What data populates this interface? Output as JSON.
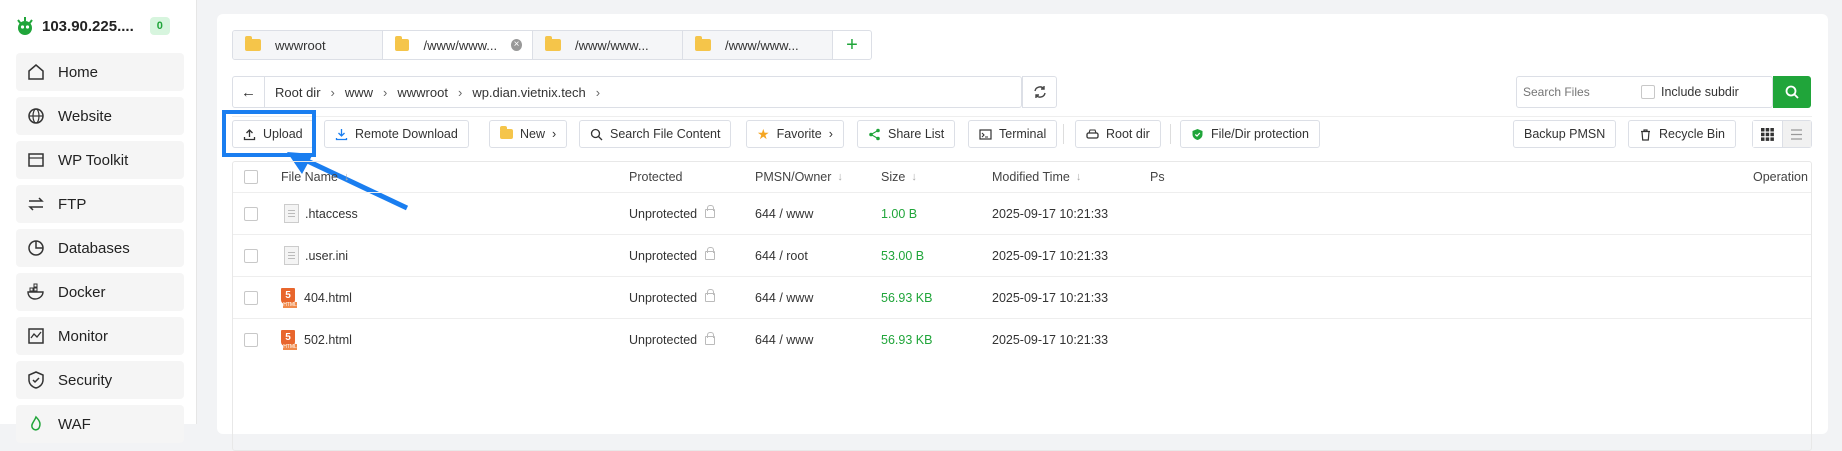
{
  "sidebar": {
    "server": "103.90.225....",
    "badge": "0",
    "items": [
      {
        "label": "Home",
        "icon": "home-icon"
      },
      {
        "label": "Website",
        "icon": "globe-icon"
      },
      {
        "label": "WP Toolkit",
        "icon": "wp-toolkit-icon"
      },
      {
        "label": "FTP",
        "icon": "ftp-icon"
      },
      {
        "label": "Databases",
        "icon": "database-icon"
      },
      {
        "label": "Docker",
        "icon": "docker-icon"
      },
      {
        "label": "Monitor",
        "icon": "monitor-icon"
      },
      {
        "label": "Security",
        "icon": "shield-icon"
      },
      {
        "label": "WAF",
        "icon": "waf-icon"
      }
    ]
  },
  "tabs": [
    {
      "label": "wwwroot"
    },
    {
      "label": "/www/www..."
    },
    {
      "label": "/www/www..."
    },
    {
      "label": "/www/www..."
    }
  ],
  "path": {
    "crumbs": [
      "Root dir",
      "www",
      "wwwroot",
      "wp.dian.vietnix.tech"
    ]
  },
  "search": {
    "placeholder": "Search Files",
    "include_subdir": "Include subdir"
  },
  "toolbar": {
    "upload": "Upload",
    "remote_download": "Remote Download",
    "new": "New",
    "search_content": "Search File Content",
    "favorite": "Favorite",
    "share_list": "Share List",
    "terminal": "Terminal",
    "root_dir": "Root dir",
    "protection": "File/Dir protection",
    "backup": "Backup PMSN",
    "recycle": "Recycle Bin"
  },
  "table": {
    "headers": {
      "name": "File Name",
      "protected": "Protected",
      "pmsn": "PMSN/Owner",
      "size": "Size",
      "modified": "Modified Time",
      "ps": "Ps",
      "operation": "Operation"
    },
    "rows": [
      {
        "name": ".htaccess",
        "type": "file",
        "protected": "Unprotected",
        "pmsn": "644 / www",
        "size": "1.00 B",
        "modified": "2025-09-17 10:21:33"
      },
      {
        "name": ".user.ini",
        "type": "file",
        "protected": "Unprotected",
        "pmsn": "644 / root",
        "size": "53.00 B",
        "modified": "2025-09-17 10:21:33"
      },
      {
        "name": "404.html",
        "type": "html",
        "protected": "Unprotected",
        "pmsn": "644 / www",
        "size": "56.93 KB",
        "modified": "2025-09-17 10:21:33"
      },
      {
        "name": "502.html",
        "type": "html",
        "protected": "Unprotected",
        "pmsn": "644 / www",
        "size": "56.93 KB",
        "modified": "2025-09-17 10:21:33"
      }
    ]
  },
  "colors": {
    "accent": "#20a53a",
    "highlight": "#1a7ef0"
  }
}
